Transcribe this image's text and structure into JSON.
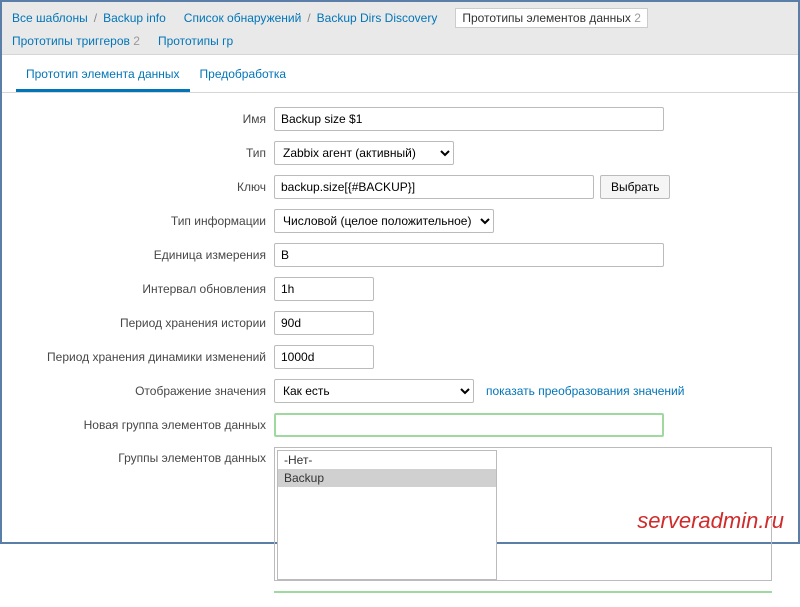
{
  "breadcrumb": {
    "all_templates": "Все шаблоны",
    "backup_info": "Backup info",
    "discovery_list": "Список обнаружений",
    "backup_dirs": "Backup Dirs Discovery",
    "item_prototypes": "Прототипы элементов данных",
    "item_prototypes_count": "2",
    "trigger_prototypes": "Прототипы триггеров",
    "trigger_prototypes_count": "2",
    "graph_prototypes": "Прототипы гр"
  },
  "tabs": {
    "item_prototype": "Прототип элемента данных",
    "preprocessing": "Предобработка"
  },
  "labels": {
    "name": "Имя",
    "type": "Тип",
    "key": "Ключ",
    "info_type": "Тип информации",
    "units": "Единица измерения",
    "update_interval": "Интервал обновления",
    "history": "Период хранения истории",
    "trends": "Период хранения динамики изменений",
    "valuemap": "Отображение значения",
    "new_group": "Новая группа элементов данных",
    "groups": "Группы элементов данных"
  },
  "values": {
    "name": "Backup size $1",
    "type": "Zabbix агент (активный)",
    "key": "backup.size[{#BACKUP}]",
    "info_type": "Числовой (целое положительное)",
    "units": "B",
    "update_interval": "1h",
    "history": "90d",
    "trends": "1000d",
    "valuemap": "Как есть"
  },
  "buttons": {
    "select": "Выбрать"
  },
  "links": {
    "show_valuemaps": "показать преобразования значений"
  },
  "group_options": {
    "none": "-Нет-",
    "backup": "Backup"
  },
  "watermark": "serveradmin.ru"
}
